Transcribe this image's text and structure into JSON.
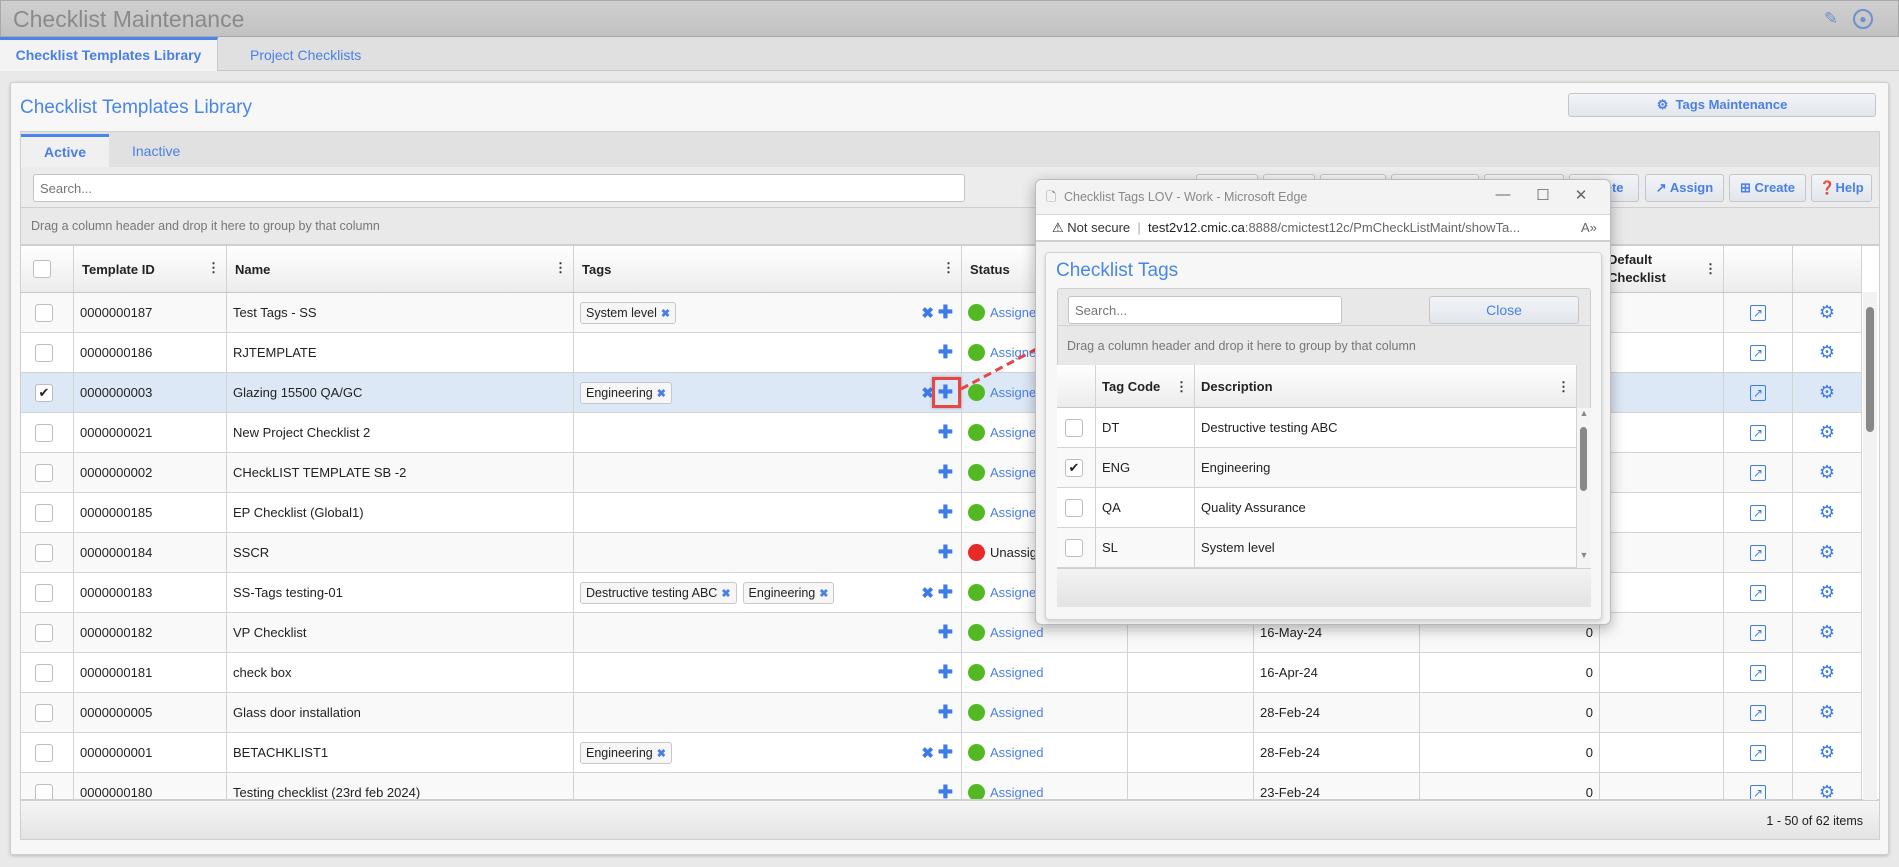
{
  "app": {
    "title": "Checklist Maintenance",
    "edit_icon": "edit-icon",
    "user_icon": "user-circle-icon"
  },
  "main_tabs": [
    {
      "label": "Checklist Templates Library",
      "active": true
    },
    {
      "label": "Project Checklists",
      "active": false
    }
  ],
  "panel": {
    "title": "Checklist Templates Library",
    "tags_maintenance_label": "Tags Maintenance"
  },
  "inner_tabs": [
    {
      "label": "Active",
      "active": true
    },
    {
      "label": "Inactive",
      "active": false
    }
  ],
  "search": {
    "placeholder": "Search..."
  },
  "toolbar": {
    "delete_label": "Delete",
    "assign_label": "Assign",
    "create_label": "Create",
    "help_label": "Help"
  },
  "group_hint": "Drag a column header and drop it here to group by that column",
  "columns": {
    "template_id": "Template ID",
    "name": "Name",
    "tags": "Tags",
    "status": "Status",
    "default_checklist": "Default Checklist"
  },
  "colors": {
    "accent": "#4a86e8",
    "assigned": "#52b823",
    "unassigned": "#e8292a",
    "selected_row": "#dce8f5",
    "highlight": "#e84545"
  },
  "rows": [
    {
      "id": "0000000187",
      "name": "Test Tags - SS",
      "tags": [
        "System level"
      ],
      "status": "Assigned",
      "checked": false
    },
    {
      "id": "0000000186",
      "name": "RJTEMPLATE",
      "tags": [],
      "status": "Assigned",
      "checked": false
    },
    {
      "id": "0000000003",
      "name": "Glazing 15500 QA/GC",
      "tags": [
        "Engineering"
      ],
      "status": "Assigned",
      "checked": true
    },
    {
      "id": "0000000021",
      "name": "New Project Checklist 2",
      "tags": [],
      "status": "Assigned",
      "checked": false
    },
    {
      "id": "0000000002",
      "name": "CHeckLIST TEMPLATE SB -2",
      "tags": [],
      "status": "Assigned",
      "checked": false
    },
    {
      "id": "0000000185",
      "name": "EP Checklist (Global1)",
      "tags": [],
      "status": "Assigned",
      "checked": false
    },
    {
      "id": "0000000184",
      "name": "SSCR",
      "tags": [],
      "status": "Unassigned",
      "checked": false
    },
    {
      "id": "0000000183",
      "name": "SS-Tags testing-01",
      "tags": [
        "Destructive testing ABC",
        "Engineering"
      ],
      "status": "Assigned",
      "checked": false
    },
    {
      "id": "0000000182",
      "name": "VP Checklist",
      "tags": [],
      "status": "Assigned",
      "date": "16-May-24",
      "count": "0",
      "checked": false
    },
    {
      "id": "0000000181",
      "name": "check box",
      "tags": [],
      "status": "Assigned",
      "date": "16-Apr-24",
      "count": "0",
      "checked": false
    },
    {
      "id": "0000000005",
      "name": "Glass door installation",
      "tags": [],
      "status": "Assigned",
      "date": "28-Feb-24",
      "count": "0",
      "checked": false
    },
    {
      "id": "0000000001",
      "name": "BETACHKLIST1",
      "tags": [
        "Engineering"
      ],
      "status": "Assigned",
      "date": "28-Feb-24",
      "count": "0",
      "checked": false
    },
    {
      "id": "0000000180",
      "name": "Testing checklist (23rd feb 2024)",
      "tags": [],
      "status": "Assigned",
      "date": "23-Feb-24",
      "count": "0",
      "checked": false
    }
  ],
  "pager": {
    "text": "1 - 50 of 62 items"
  },
  "popup": {
    "window_title": "Checklist Tags LOV - Work - Microsoft Edge",
    "security": "Not secure",
    "url_host": "test2v12.cmic.ca",
    "url_rest": ":8888/cmictest12c/PmCheckListMaint/showTa...",
    "title": "Checklist Tags",
    "search_placeholder": "Search...",
    "close_label": "Close",
    "group_hint": "Drag a column header and drop it here to group by that column",
    "columns": {
      "code": "Tag Code",
      "description": "Description"
    },
    "rows": [
      {
        "code": "DT",
        "description": "Destructive testing ABC",
        "checked": false
      },
      {
        "code": "ENG",
        "description": "Engineering",
        "checked": true
      },
      {
        "code": "QA",
        "description": "Quality Assurance",
        "checked": false
      },
      {
        "code": "SL",
        "description": "System level",
        "checked": false
      }
    ]
  }
}
